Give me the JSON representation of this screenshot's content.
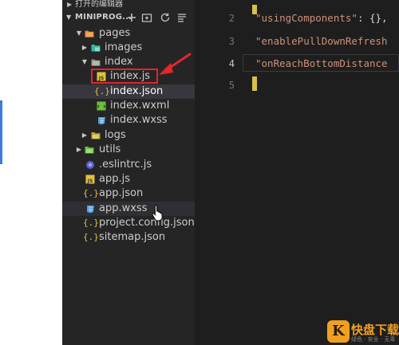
{
  "explorer": {
    "open_editors_label": "打开的编辑器",
    "project_label": "MINIPROG...",
    "tree": {
      "pages": "pages",
      "images": "images",
      "index": "index",
      "index_js": "index.js",
      "index_json": "index.json",
      "index_wxml": "index.wxml",
      "index_wxss": "index.wxss",
      "logs": "logs",
      "utils": "utils",
      "eslintrc": ".eslintrc.js",
      "app_js": "app.js",
      "app_json": "app.json",
      "app_wxss": "app.wxss",
      "project_config": "project.config.json",
      "sitemap": "sitemap.json"
    }
  },
  "editor": {
    "line_numbers": [
      "2",
      "3",
      "4",
      "5"
    ],
    "line2_key": "\"usingComponents\"",
    "line2_rest": ": {},",
    "line3_key": "\"enablePullDownRefresh",
    "line4_key": "\"onReachBottomDistance",
    "line5_brace": "}"
  },
  "watermark": {
    "logo_char": "K",
    "name": "快盘下载",
    "subtitle": "绿色 · 安全 · 无毒"
  },
  "colors": {
    "highlight_border": "#e3262b",
    "annotation_arrow": "#e3262b",
    "folder_orange": "#d9823b",
    "images_teal": "#3ab7a0",
    "js_yellow": "#e0c23b",
    "wxml_green": "#6bbf3a",
    "wxss_blue": "#4a9fe0"
  }
}
